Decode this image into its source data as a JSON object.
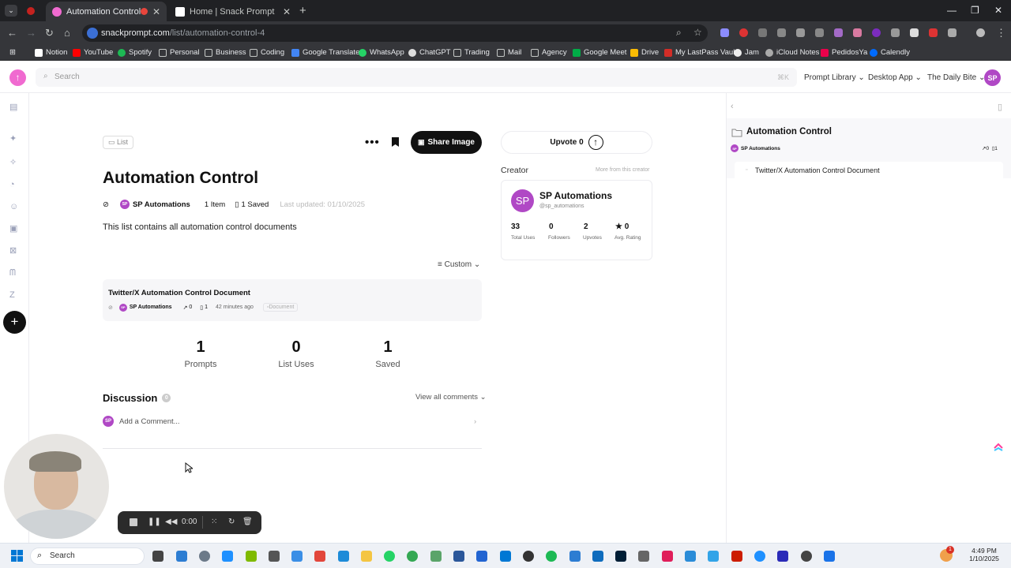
{
  "browser": {
    "tabs": [
      {
        "title": "Automation Control | Snack Prompt",
        "active": true
      },
      {
        "title": "Home | Snack Prompt",
        "active": false
      }
    ],
    "url_host": "snackprompt.com",
    "url_path": "/list/automation-control-4",
    "bookmarks": [
      "Notion",
      "YouTube",
      "Spotify",
      "Personal",
      "Business",
      "Coding",
      "Google Translate",
      "WhatsApp",
      "ChatGPT",
      "Trading",
      "Mail",
      "Agency",
      "Google Meet",
      "Drive",
      "My LastPass Vault",
      "Jam",
      "iCloud Notes",
      "PedidosYa",
      "Calendly"
    ]
  },
  "app": {
    "search_placeholder": "Search",
    "search_shortcut": "⌘K",
    "nav": [
      "Prompt Library",
      "Desktop App",
      "The Daily Bite"
    ],
    "user_initials": "SP",
    "brand_color": "#f06ad0"
  },
  "list": {
    "tag": "List",
    "title": "Automation Control",
    "author": "SP Automations",
    "items_count": "1 Item",
    "saved_count": "1 Saved",
    "last_updated": "Last updated: 01/10/2025",
    "description": "This list contains all automation control documents",
    "sort_label": "Custom",
    "share_label": "Share Image",
    "upvote_label": "Upvote",
    "upvote_count": "0"
  },
  "item": {
    "title": "Twitter/X Automation Control Document",
    "author": "SP Automations",
    "shares": "0",
    "saves": "1",
    "time": "42 minutes ago",
    "badge": "Document"
  },
  "stats": [
    {
      "value": "1",
      "label": "Prompts"
    },
    {
      "value": "0",
      "label": "List Uses"
    },
    {
      "value": "1",
      "label": "Saved"
    }
  ],
  "discussion": {
    "title": "Discussion",
    "count": "0",
    "view_all": "View all comments",
    "placeholder": "Add a Comment..."
  },
  "creator": {
    "heading": "Creator",
    "more": "More from this creator",
    "name": "SP Automations",
    "handle": "@sp_automations",
    "stats": [
      {
        "value": "33",
        "label": "Total Uses"
      },
      {
        "value": "0",
        "label": "Followers"
      },
      {
        "value": "2",
        "label": "Upvotes"
      },
      {
        "value": "★ 0",
        "label": "Avg. Rating"
      }
    ]
  },
  "panel": {
    "title": "Automation Control",
    "author": "SP Automations",
    "shares": "0",
    "saves": "1",
    "doc": "Twitter/X Automation Control Document"
  },
  "recorder": {
    "time": "0:00"
  },
  "taskbar": {
    "search": "Search",
    "time": "4:49 PM",
    "date": "1/10/2025",
    "badge": "1"
  }
}
